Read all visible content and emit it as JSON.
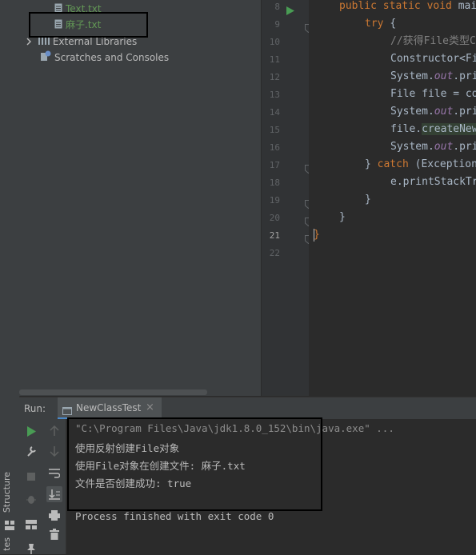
{
  "project_tree": {
    "items": [
      {
        "label": "Text.txt",
        "color": "#629755"
      },
      {
        "label": "麻子.txt",
        "color": "#629755"
      },
      {
        "label": "External Libraries"
      },
      {
        "label": "Scratches and Consoles"
      }
    ]
  },
  "left_strip": {
    "structure_label": "Structure",
    "favorites_label": "tes"
  },
  "editor": {
    "line_numbers": [
      "8",
      "9",
      "10",
      "11",
      "12",
      "13",
      "14",
      "15",
      "16",
      "17",
      "18",
      "19",
      "20",
      "21",
      "22"
    ],
    "lines": [
      {
        "p": [
          [
            "kw",
            "public static void "
          ],
          [
            "pl",
            "mai"
          ]
        ]
      },
      {
        "p": [
          [
            "kw",
            "try "
          ],
          [
            "pl",
            "{"
          ]
        ]
      },
      {
        "p": [
          [
            "cm",
            "//获得File类型C"
          ]
        ]
      },
      {
        "p": [
          [
            "pl",
            "Constructor<Fi"
          ]
        ]
      },
      {
        "p": [
          [
            "pl",
            "System."
          ],
          [
            "st",
            "out"
          ],
          [
            "pl",
            ".pri"
          ]
        ]
      },
      {
        "p": [
          [
            "pl",
            "File file = co"
          ]
        ]
      },
      {
        "p": [
          [
            "pl",
            "System."
          ],
          [
            "st",
            "out"
          ],
          [
            "pl",
            ".pri"
          ]
        ]
      },
      {
        "p": [
          [
            "pl",
            "file."
          ],
          [
            "hl",
            "createNew"
          ]
        ]
      },
      {
        "p": [
          [
            "pl",
            "System."
          ],
          [
            "st",
            "out"
          ],
          [
            "pl",
            ".pri"
          ]
        ]
      },
      {
        "p": [
          [
            "pl",
            "} "
          ],
          [
            "kw",
            "catch "
          ],
          [
            "pl",
            "(Exception"
          ]
        ]
      },
      {
        "p": [
          [
            "pl",
            "e.printStackTr"
          ]
        ]
      },
      {
        "p": [
          [
            "pl",
            "}"
          ]
        ]
      },
      {
        "p": [
          [
            "pl",
            "}"
          ]
        ]
      },
      {
        "p": [
          [
            "kw",
            "}"
          ]
        ]
      },
      {
        "p": []
      }
    ]
  },
  "run_panel": {
    "run_label": "Run:",
    "tab_label": "NewClassTest",
    "close_glyph": "×",
    "console_lines": [
      "\"C:\\Program Files\\Java\\jdk1.8.0_152\\bin\\java.exe\" ...",
      "使用反射创建File对象",
      "使用File对象在创建文件: 麻子.txt",
      "文件是否创建成功: true",
      "",
      "Process finished with exit code 0"
    ]
  },
  "colors": {
    "accent_run": "#499c54",
    "background": "#2b2b2b",
    "panel": "#3c3f41"
  }
}
